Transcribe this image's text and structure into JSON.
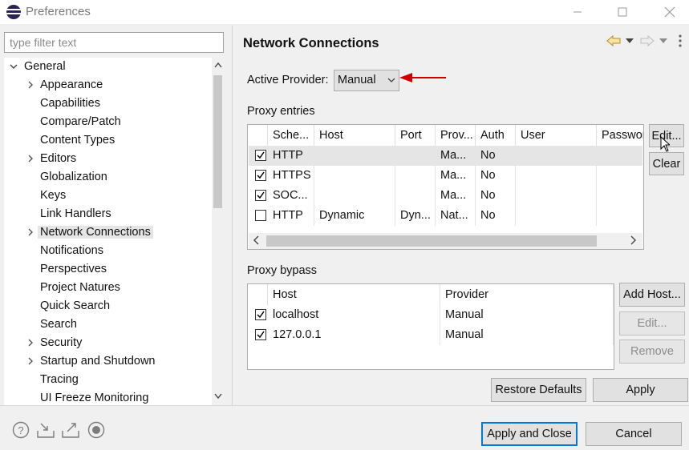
{
  "window": {
    "title": "Preferences"
  },
  "filter": {
    "placeholder": "type filter text"
  },
  "tree": {
    "root": "General",
    "items": [
      {
        "label": "Appearance",
        "expandable": true
      },
      {
        "label": "Capabilities",
        "expandable": false
      },
      {
        "label": "Compare/Patch",
        "expandable": false
      },
      {
        "label": "Content Types",
        "expandable": false
      },
      {
        "label": "Editors",
        "expandable": true
      },
      {
        "label": "Globalization",
        "expandable": false
      },
      {
        "label": "Keys",
        "expandable": false
      },
      {
        "label": "Link Handlers",
        "expandable": false
      },
      {
        "label": "Network Connections",
        "expandable": true,
        "selected": true
      },
      {
        "label": "Notifications",
        "expandable": false
      },
      {
        "label": "Perspectives",
        "expandable": false
      },
      {
        "label": "Project Natures",
        "expandable": false
      },
      {
        "label": "Quick Search",
        "expandable": false
      },
      {
        "label": "Search",
        "expandable": false
      },
      {
        "label": "Security",
        "expandable": true
      },
      {
        "label": "Startup and Shutdown",
        "expandable": true
      },
      {
        "label": "Tracing",
        "expandable": false
      },
      {
        "label": "UI Freeze Monitoring",
        "expandable": false
      }
    ]
  },
  "page": {
    "title": "Network Connections",
    "active_provider_label": "Active Provider:",
    "active_provider_value": "Manual",
    "proxy_entries_label": "Proxy entries",
    "proxy_bypass_label": "Proxy bypass"
  },
  "proxy_entries": {
    "columns": [
      "Sche...",
      "Host",
      "Port",
      "Prov...",
      "Auth",
      "User",
      "Passwor"
    ],
    "rows": [
      {
        "checked": true,
        "cells": [
          "HTTP",
          "",
          "",
          "Ma...",
          "No",
          "",
          ""
        ]
      },
      {
        "checked": true,
        "cells": [
          "HTTPS",
          "",
          "",
          "Ma...",
          "No",
          "",
          ""
        ]
      },
      {
        "checked": true,
        "cells": [
          "SOC...",
          "",
          "",
          "Ma...",
          "No",
          "",
          ""
        ]
      },
      {
        "checked": false,
        "cells": [
          "HTTP",
          "Dynamic",
          "Dyn...",
          "Nat...",
          "No",
          "",
          ""
        ]
      }
    ],
    "buttons": {
      "edit": "Edit...",
      "clear": "Clear"
    }
  },
  "proxy_bypass": {
    "columns": [
      "Host",
      "Provider"
    ],
    "rows": [
      {
        "checked": true,
        "cells": [
          "localhost",
          "Manual"
        ]
      },
      {
        "checked": true,
        "cells": [
          "127.0.0.1",
          "Manual"
        ]
      }
    ],
    "buttons": {
      "add_host": "Add Host...",
      "edit": "Edit...",
      "remove": "Remove"
    }
  },
  "actions": {
    "restore_defaults": "Restore Defaults",
    "apply": "Apply",
    "apply_and_close": "Apply and Close",
    "cancel": "Cancel"
  },
  "colors": {
    "annotation_arrow": "#cc0000",
    "focus_border": "#0078d7"
  },
  "icons": [
    "help-icon",
    "import-icon",
    "export-icon",
    "record-icon",
    "back-icon",
    "forward-icon",
    "view-menu-icon"
  ]
}
